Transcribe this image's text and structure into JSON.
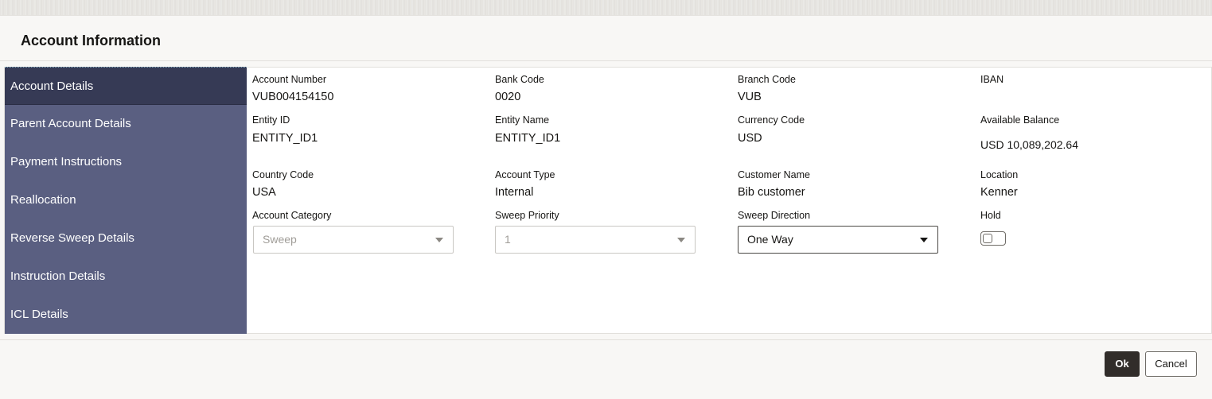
{
  "dialog": {
    "title": "Account Information"
  },
  "sidebar": {
    "items": [
      {
        "label": "Account Details",
        "active": true
      },
      {
        "label": "Parent Account Details"
      },
      {
        "label": "Payment Instructions"
      },
      {
        "label": "Reallocation"
      },
      {
        "label": "Reverse Sweep Details"
      },
      {
        "label": "Instruction Details"
      },
      {
        "label": "ICL Details"
      }
    ]
  },
  "fields": {
    "account_number": {
      "label": "Account Number",
      "value": "VUB004154150"
    },
    "bank_code": {
      "label": "Bank Code",
      "value": "0020"
    },
    "branch_code": {
      "label": "Branch Code",
      "value": "VUB"
    },
    "iban": {
      "label": "IBAN",
      "value": ""
    },
    "entity_id": {
      "label": "Entity ID",
      "value": "ENTITY_ID1"
    },
    "entity_name": {
      "label": "Entity Name",
      "value": "ENTITY_ID1"
    },
    "currency_code": {
      "label": "Currency Code",
      "value": "USD"
    },
    "available_balance": {
      "label": "Available Balance",
      "value": "USD 10,089,202.64"
    },
    "country_code": {
      "label": "Country Code",
      "value": "USA"
    },
    "account_type": {
      "label": "Account Type",
      "value": "Internal"
    },
    "customer_name": {
      "label": "Customer Name",
      "value": "Bib customer"
    },
    "location": {
      "label": "Location",
      "value": "Kenner"
    },
    "account_category": {
      "label": "Account Category",
      "value": "Sweep",
      "disabled": true
    },
    "sweep_priority": {
      "label": "Sweep Priority",
      "value": "1",
      "disabled": true
    },
    "sweep_direction": {
      "label": "Sweep Direction",
      "value": "One Way"
    },
    "hold": {
      "label": "Hold",
      "checked": false
    }
  },
  "footer": {
    "ok_label": "Ok",
    "cancel_label": "Cancel"
  },
  "icons": {
    "dropdown": "chevron-down-icon",
    "toggle": "toggle-switch"
  },
  "colors": {
    "sidebar_bg": "#5a5f81",
    "sidebar_active_bg": "#363a55",
    "primary_button_bg": "#312d2a"
  }
}
